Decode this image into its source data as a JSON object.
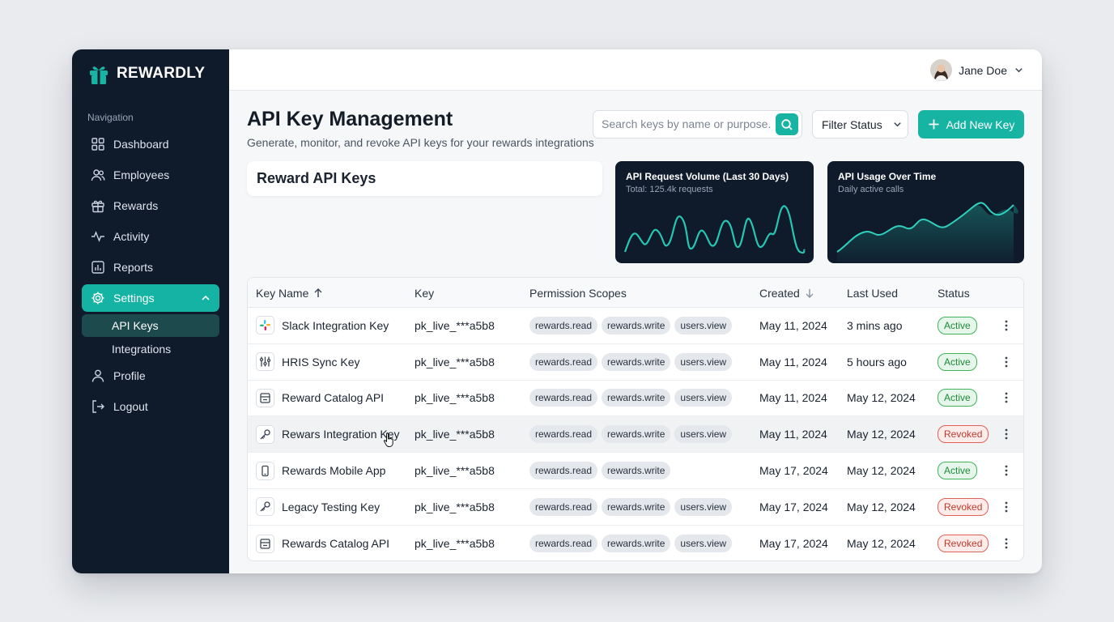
{
  "brand": {
    "name": "REWARDLY"
  },
  "sidebar": {
    "heading": "Navigation",
    "items": [
      {
        "label": "Dashboard",
        "icon": "grid-icon"
      },
      {
        "label": "Employees",
        "icon": "users-icon"
      },
      {
        "label": "Rewards",
        "icon": "gift-icon"
      },
      {
        "label": "Activity",
        "icon": "activity-icon"
      },
      {
        "label": "Reports",
        "icon": "chart-icon"
      },
      {
        "label": "Settings",
        "icon": "gear-icon",
        "active": true
      },
      {
        "label": "Profile",
        "icon": "user-icon"
      },
      {
        "label": "Logout",
        "icon": "logout-icon"
      }
    ],
    "settings_sub": [
      {
        "label": "API Keys",
        "active": true
      },
      {
        "label": "Integrations"
      }
    ]
  },
  "user": {
    "name": "Jane Doe"
  },
  "page": {
    "title": "API Key Management",
    "subtitle": "Generate, monitor, and revoke API keys for your rewards integrations"
  },
  "search": {
    "placeholder": "Search keys by name or purpose..."
  },
  "filter": {
    "label": "Filter Status"
  },
  "add_button": {
    "label": "Add New Key"
  },
  "section": {
    "title": "Reward API Keys"
  },
  "charts": {
    "volume": {
      "title": "API Request Volume (Last 30 Days)",
      "subtitle": "Total: 125.4k requests"
    },
    "usage": {
      "title": "API Usage Over Time",
      "subtitle": "Daily active calls"
    }
  },
  "table": {
    "headers": {
      "name": "Key Name",
      "key": "Key",
      "scopes": "Permission Scopes",
      "created": "Created",
      "last_used": "Last Used",
      "status": "Status"
    },
    "rows": [
      {
        "name": "Slack Integration Key",
        "icon": "slack-icon",
        "key": "pk_live_***a5b8",
        "scopes": [
          "rewards.read",
          "rewards.write",
          "users.view"
        ],
        "created": "May 11, 2024",
        "last_used": "3 mins ago",
        "status": "Active"
      },
      {
        "name": "HRIS Sync Key",
        "icon": "sliders-icon",
        "key": "pk_live_***a5b8",
        "scopes": [
          "rewards.read",
          "rewards.write",
          "users.view"
        ],
        "created": "May 11, 2024",
        "last_used": "5 hours ago",
        "status": "Active"
      },
      {
        "name": "Reward Catalog API",
        "icon": "catalog-icon",
        "key": "pk_live_***a5b8",
        "scopes": [
          "rewards.read",
          "rewards.write",
          "users.view"
        ],
        "created": "May 11, 2024",
        "last_used": "May 12, 2024",
        "status": "Active"
      },
      {
        "name": "Rewars Integration Key",
        "icon": "key-icon",
        "key": "pk_live_***a5b8",
        "scopes": [
          "rewards.read",
          "rewards.write",
          "users.view"
        ],
        "created": "May 11, 2024",
        "last_used": "May 12, 2024",
        "status": "Revoked"
      },
      {
        "name": "Rewards Mobile App",
        "icon": "phone-icon",
        "key": "pk_live_***a5b8",
        "scopes": [
          "rewards.read",
          "rewards.write"
        ],
        "created": "May 17, 2024",
        "last_used": "May 12, 2024",
        "status": "Active"
      },
      {
        "name": "Legacy Testing Key",
        "icon": "key-icon",
        "key": "pk_live_***a5b8",
        "scopes": [
          "rewards.read",
          "rewards.write",
          "users.view"
        ],
        "created": "May 17, 2024",
        "last_used": "May 12, 2024",
        "status": "Revoked"
      },
      {
        "name": "Rewards Catalog API",
        "icon": "catalog-icon",
        "key": "pk_live_***a5b8",
        "scopes": [
          "rewards.read",
          "rewards.write",
          "users.view"
        ],
        "created": "May 17, 2024",
        "last_used": "May 12, 2024",
        "status": "Revoked"
      }
    ]
  },
  "colors": {
    "accent": "#17b3a3",
    "sidebar": "#0f1a2b",
    "active": "#1e8a3a",
    "revoked": "#c0392b"
  }
}
